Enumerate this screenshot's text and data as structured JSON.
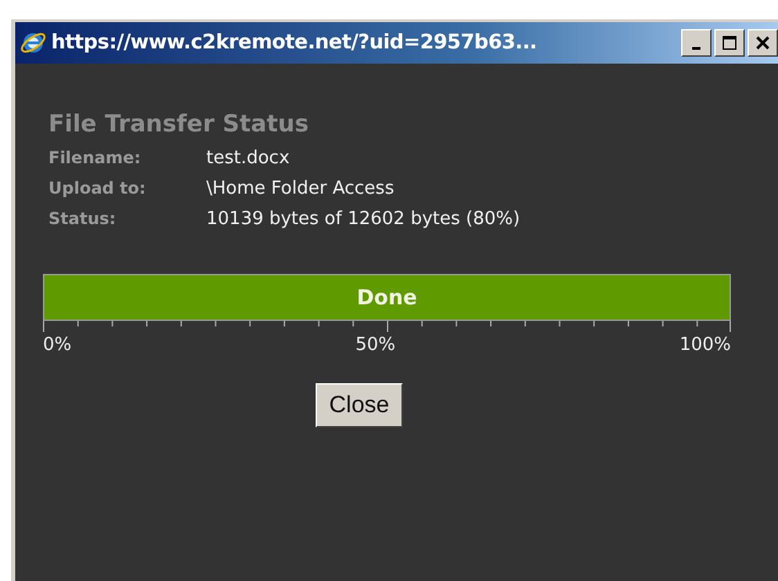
{
  "window": {
    "title": "https://www.c2kremote.net/?uid=2957b63..."
  },
  "heading": "File Transfer Status",
  "fields": [
    {
      "label": "Filename:",
      "value": "test.docx"
    },
    {
      "label": "Upload to:",
      "value": "\\Home Folder Access"
    },
    {
      "label": "Status:",
      "value": "10139 bytes of 12602 bytes (80%)"
    }
  ],
  "progress": {
    "level": 1,
    "text": "Done",
    "scale": [
      "0%",
      "50%",
      "100%"
    ]
  },
  "buttons": [
    "Close"
  ]
}
